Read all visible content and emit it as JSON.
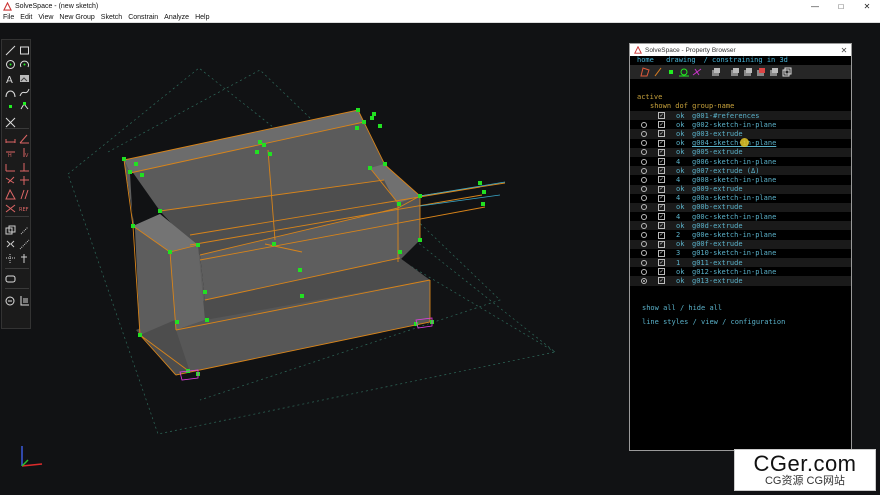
{
  "window": {
    "title": "SolveSpace - (new sketch)",
    "minimize": "—",
    "maximize": "□",
    "close": "✕"
  },
  "menu": [
    "File",
    "Edit",
    "View",
    "New Group",
    "Sketch",
    "Constrain",
    "Analyze",
    "Help"
  ],
  "toolbar": {
    "tools": [
      "line-tool-icon",
      "rectangle-tool-icon",
      "circle-tool-icon",
      "arc-tool-icon",
      "text-tool-icon",
      "image-tool-icon",
      "tangent-arc-icon",
      "bezier-icon",
      "point-tool-icon",
      "workplane-icon",
      "split-curves-icon",
      "distance-constraint-icon",
      "angle-constraint-icon",
      "horizontal-constraint-icon",
      "vertical-constraint-icon",
      "parallel-constraint-icon",
      "perpendicular-constraint-icon",
      "point-on-entity-icon",
      "symmetric-icon",
      "equal-constraint-icon",
      "same-orientation-icon",
      "other-supplementary-icon",
      "reference-icon",
      "nearest-isometric-icon",
      "nearest-ortho-icon",
      "construction-icon",
      "pt-on-face-icon",
      "mid-point-icon",
      "lathe-icon",
      "extrude-icon",
      "step-dimension-icon",
      "sketch-in-3d-icon"
    ],
    "ref_label": "REF"
  },
  "property_browser": {
    "title": "SolveSpace - Property Browser",
    "close": "✕",
    "nav": {
      "home": "home",
      "link1": "drawing",
      "sep": "/",
      "link2": "constraining in 3d"
    },
    "icons": [
      "show-workplanes-icon",
      "show-normals-icon",
      "show-points-icon",
      "show-constraints-icon",
      "show-construction-icon",
      "show-faces-icon",
      "show-shaded-icon",
      "show-edges-icon",
      "show-outlines-icon",
      "show-mesh-icon",
      "show-hidden-lines-icon"
    ],
    "active_label": "active",
    "header": "shown dof group-name",
    "groups": [
      {
        "dof": "",
        "ok": "ok",
        "name": "g001-#references",
        "shown": true,
        "radio": false,
        "active": false,
        "alt": true
      },
      {
        "dof": "",
        "ok": "ok",
        "name": "g002-sketch-in-plane",
        "shown": true,
        "radio": true,
        "active": false,
        "alt": false
      },
      {
        "dof": "",
        "ok": "ok",
        "name": "g003-extrude",
        "shown": true,
        "radio": true,
        "active": false,
        "alt": true
      },
      {
        "dof": "",
        "ok": "ok",
        "name": "g004-sketch-in-plane",
        "shown": true,
        "radio": true,
        "active": false,
        "alt": false,
        "underline": true
      },
      {
        "dof": "",
        "ok": "ok",
        "name": "g005-extrude",
        "shown": true,
        "radio": true,
        "active": false,
        "alt": true
      },
      {
        "dof": "4",
        "ok": "",
        "name": "g006-sketch-in-plane",
        "shown": true,
        "radio": true,
        "active": false,
        "alt": false
      },
      {
        "dof": "",
        "ok": "ok",
        "name": "g007-extrude (Δ)",
        "shown": true,
        "radio": true,
        "active": false,
        "alt": true
      },
      {
        "dof": "4",
        "ok": "",
        "name": "g008-sketch-in-plane",
        "shown": true,
        "radio": true,
        "active": false,
        "alt": false
      },
      {
        "dof": "",
        "ok": "ok",
        "name": "g009-extrude",
        "shown": true,
        "radio": true,
        "active": false,
        "alt": true
      },
      {
        "dof": "4",
        "ok": "",
        "name": "g00a-sketch-in-plane",
        "shown": true,
        "radio": true,
        "active": false,
        "alt": false
      },
      {
        "dof": "",
        "ok": "ok",
        "name": "g00b-extrude",
        "shown": true,
        "radio": true,
        "active": false,
        "alt": true
      },
      {
        "dof": "4",
        "ok": "",
        "name": "g00c-sketch-in-plane",
        "shown": true,
        "radio": true,
        "active": false,
        "alt": false
      },
      {
        "dof": "",
        "ok": "ok",
        "name": "g00d-extrude",
        "shown": true,
        "radio": true,
        "active": false,
        "alt": true
      },
      {
        "dof": "2",
        "ok": "",
        "name": "g00e-sketch-in-plane",
        "shown": true,
        "radio": true,
        "active": false,
        "alt": false
      },
      {
        "dof": "",
        "ok": "ok",
        "name": "g00f-extrude",
        "shown": true,
        "radio": true,
        "active": false,
        "alt": true
      },
      {
        "dof": "3",
        "ok": "",
        "name": "g010-sketch-in-plane",
        "shown": true,
        "radio": true,
        "active": false,
        "alt": false
      },
      {
        "dof": "1",
        "ok": "",
        "name": "g011-extrude",
        "shown": true,
        "radio": true,
        "active": false,
        "alt": true
      },
      {
        "dof": "",
        "ok": "ok",
        "name": "g012-sketch-in-plane",
        "shown": true,
        "radio": true,
        "active": false,
        "alt": false
      },
      {
        "dof": "",
        "ok": "ok",
        "name": "g013-extrude",
        "shown": true,
        "radio": true,
        "active": true,
        "alt": true
      }
    ],
    "show_all": "show all",
    "slash": "/",
    "hide_all": "hide all",
    "line_styles": "line styles",
    "view": "view",
    "configuration": "configuration"
  },
  "watermark": {
    "line1": "CGer.com",
    "line2": "CG资源  CG网站"
  },
  "colors": {
    "accent_cyan": "#5ab1c9",
    "header_gold": "#c8a23c",
    "edge_orange": "#e08a1e",
    "point_green": "#22e022",
    "face_gray": "#595959"
  }
}
